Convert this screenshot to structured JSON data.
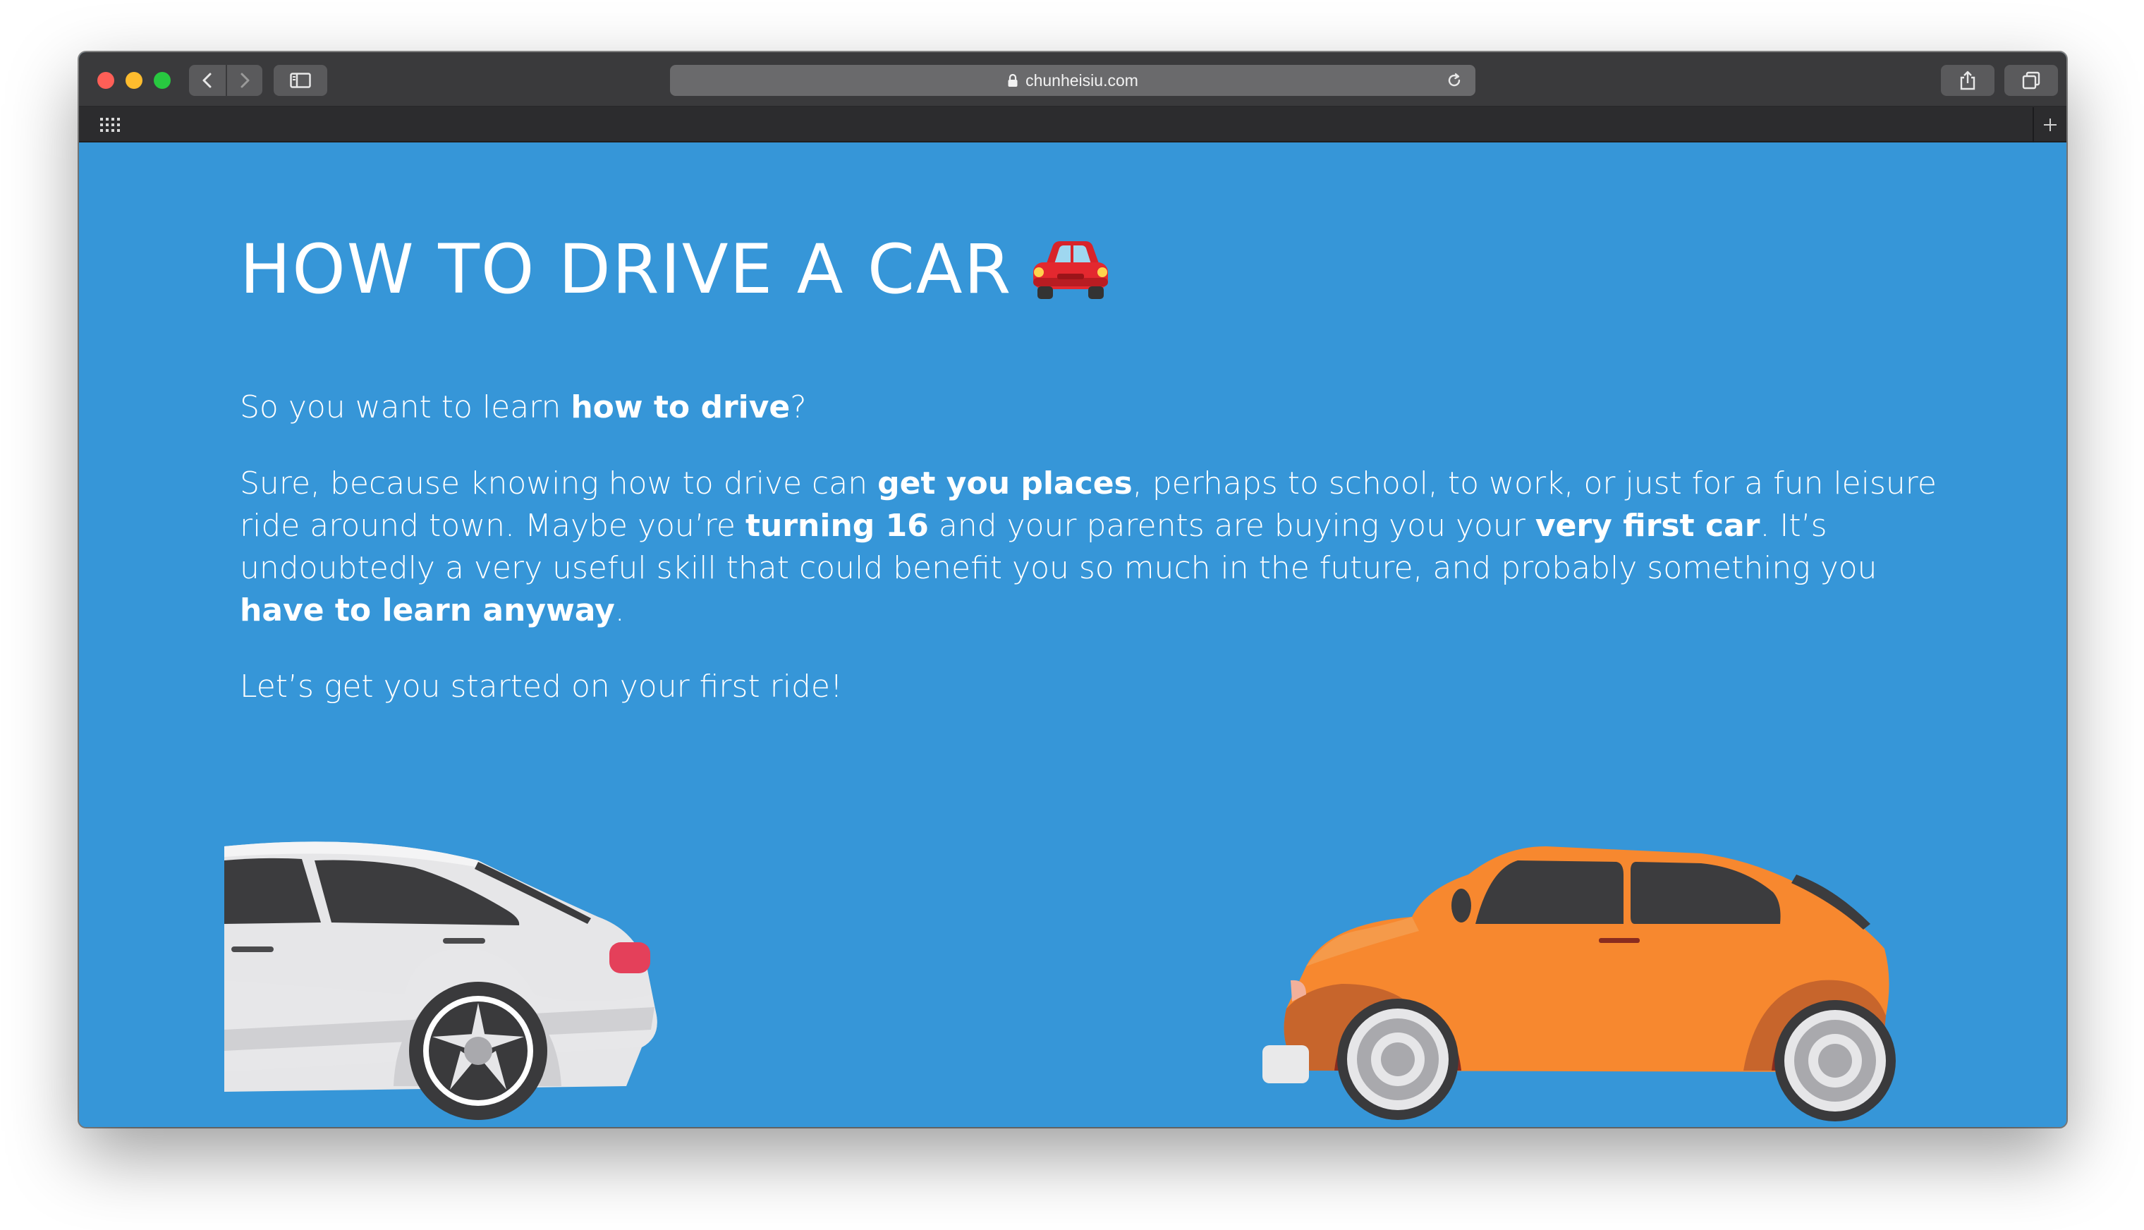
{
  "browser": {
    "url": "chunheisiu.com"
  },
  "page": {
    "title": "HOW TO DRIVE A CAR",
    "intro": {
      "pre": "So you want to learn ",
      "bold": "how to drive",
      "post": "?"
    },
    "para2": {
      "t1": "Sure, because knowing how to drive can ",
      "b1": "get you places",
      "t2": ", perhaps to school, to work, or just for a fun leisure ride around town. Maybe you’re ",
      "b2": "turning 16",
      "t3": " and your parents are buying you your ",
      "b3": "very first car",
      "t4": ". It’s undoubtedly a very useful skill that could benefit you so much in the future, and probably something you ",
      "b4": "have to learn anyway",
      "t5": "."
    },
    "para3": "Let’s get you started on your first ride!"
  },
  "colors": {
    "page_background": "#3696d8",
    "left_car": "#e6e6e8",
    "right_car": "#f7882f"
  },
  "icons": [
    "red-car-emoji-icon",
    "lock-icon",
    "reload-icon",
    "share-icon",
    "tabs-icon",
    "sidebar-icon",
    "grid-icon",
    "plus-icon"
  ]
}
